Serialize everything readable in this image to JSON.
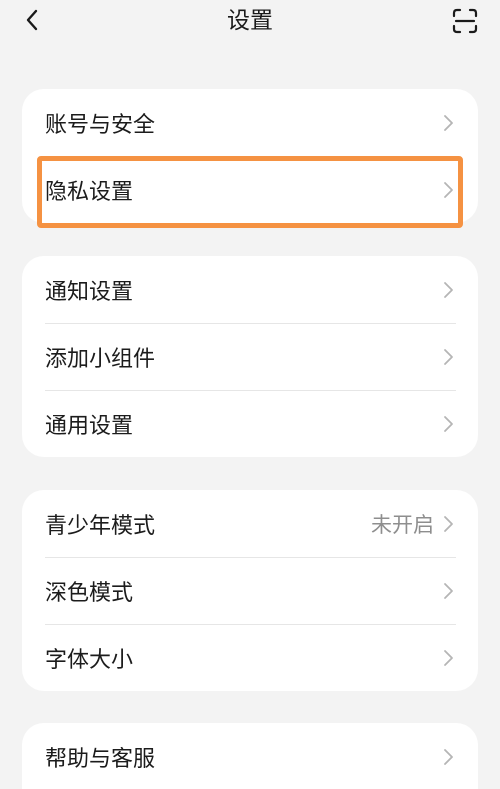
{
  "header": {
    "title": "设置",
    "back_icon": "chevron-left-icon",
    "scan_icon": "scan-icon"
  },
  "groups": [
    {
      "items": [
        {
          "label": "账号与安全",
          "value": ""
        },
        {
          "label": "隐私设置",
          "value": ""
        }
      ]
    },
    {
      "items": [
        {
          "label": "通知设置",
          "value": ""
        },
        {
          "label": "添加小组件",
          "value": ""
        },
        {
          "label": "通用设置",
          "value": ""
        }
      ]
    },
    {
      "items": [
        {
          "label": "青少年模式",
          "value": "未开启"
        },
        {
          "label": "深色模式",
          "value": ""
        },
        {
          "label": "字体大小",
          "value": ""
        }
      ]
    },
    {
      "items": [
        {
          "label": "帮助与客服",
          "value": ""
        }
      ]
    }
  ],
  "colors": {
    "background": "#f3f3f3",
    "card": "#ffffff",
    "highlight": "#f59242",
    "secondary_text": "#8e8e8e",
    "chevron": "#b5b5b5"
  }
}
